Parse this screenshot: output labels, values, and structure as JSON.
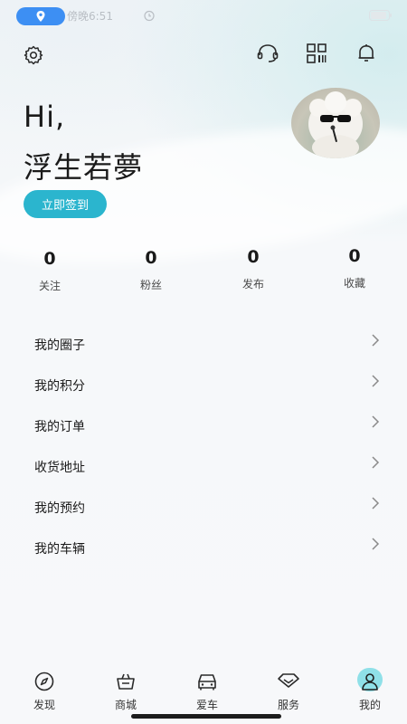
{
  "status_bar": {
    "time": "傍晚6:51"
  },
  "header": {
    "settings_icon": "gear-icon",
    "support_icon": "headset-icon",
    "scan_icon": "qr-code-icon",
    "notification_icon": "bell-icon"
  },
  "profile": {
    "greeting": "Hi,",
    "username": "浮生若夢",
    "checkin_label": "立即签到"
  },
  "stats": [
    {
      "value": "0",
      "label": "关注"
    },
    {
      "value": "0",
      "label": "粉丝"
    },
    {
      "value": "0",
      "label": "发布"
    },
    {
      "value": "0",
      "label": "收藏"
    }
  ],
  "menu": [
    {
      "label": "我的圈子"
    },
    {
      "label": "我的积分"
    },
    {
      "label": "我的订单"
    },
    {
      "label": "收货地址"
    },
    {
      "label": "我的预约"
    },
    {
      "label": "我的车辆"
    }
  ],
  "bottom_nav": [
    {
      "label": "发现",
      "icon": "compass-icon"
    },
    {
      "label": "商城",
      "icon": "shopping-basket-icon"
    },
    {
      "label": "爱车",
      "icon": "car-icon"
    },
    {
      "label": "服务",
      "icon": "service-icon"
    },
    {
      "label": "我的",
      "icon": "user-icon",
      "active": true
    }
  ],
  "colors": {
    "accent": "#2bb5ce",
    "location_pill": "#3d8ff3",
    "active_nav_bg": "#8fe0e8"
  }
}
